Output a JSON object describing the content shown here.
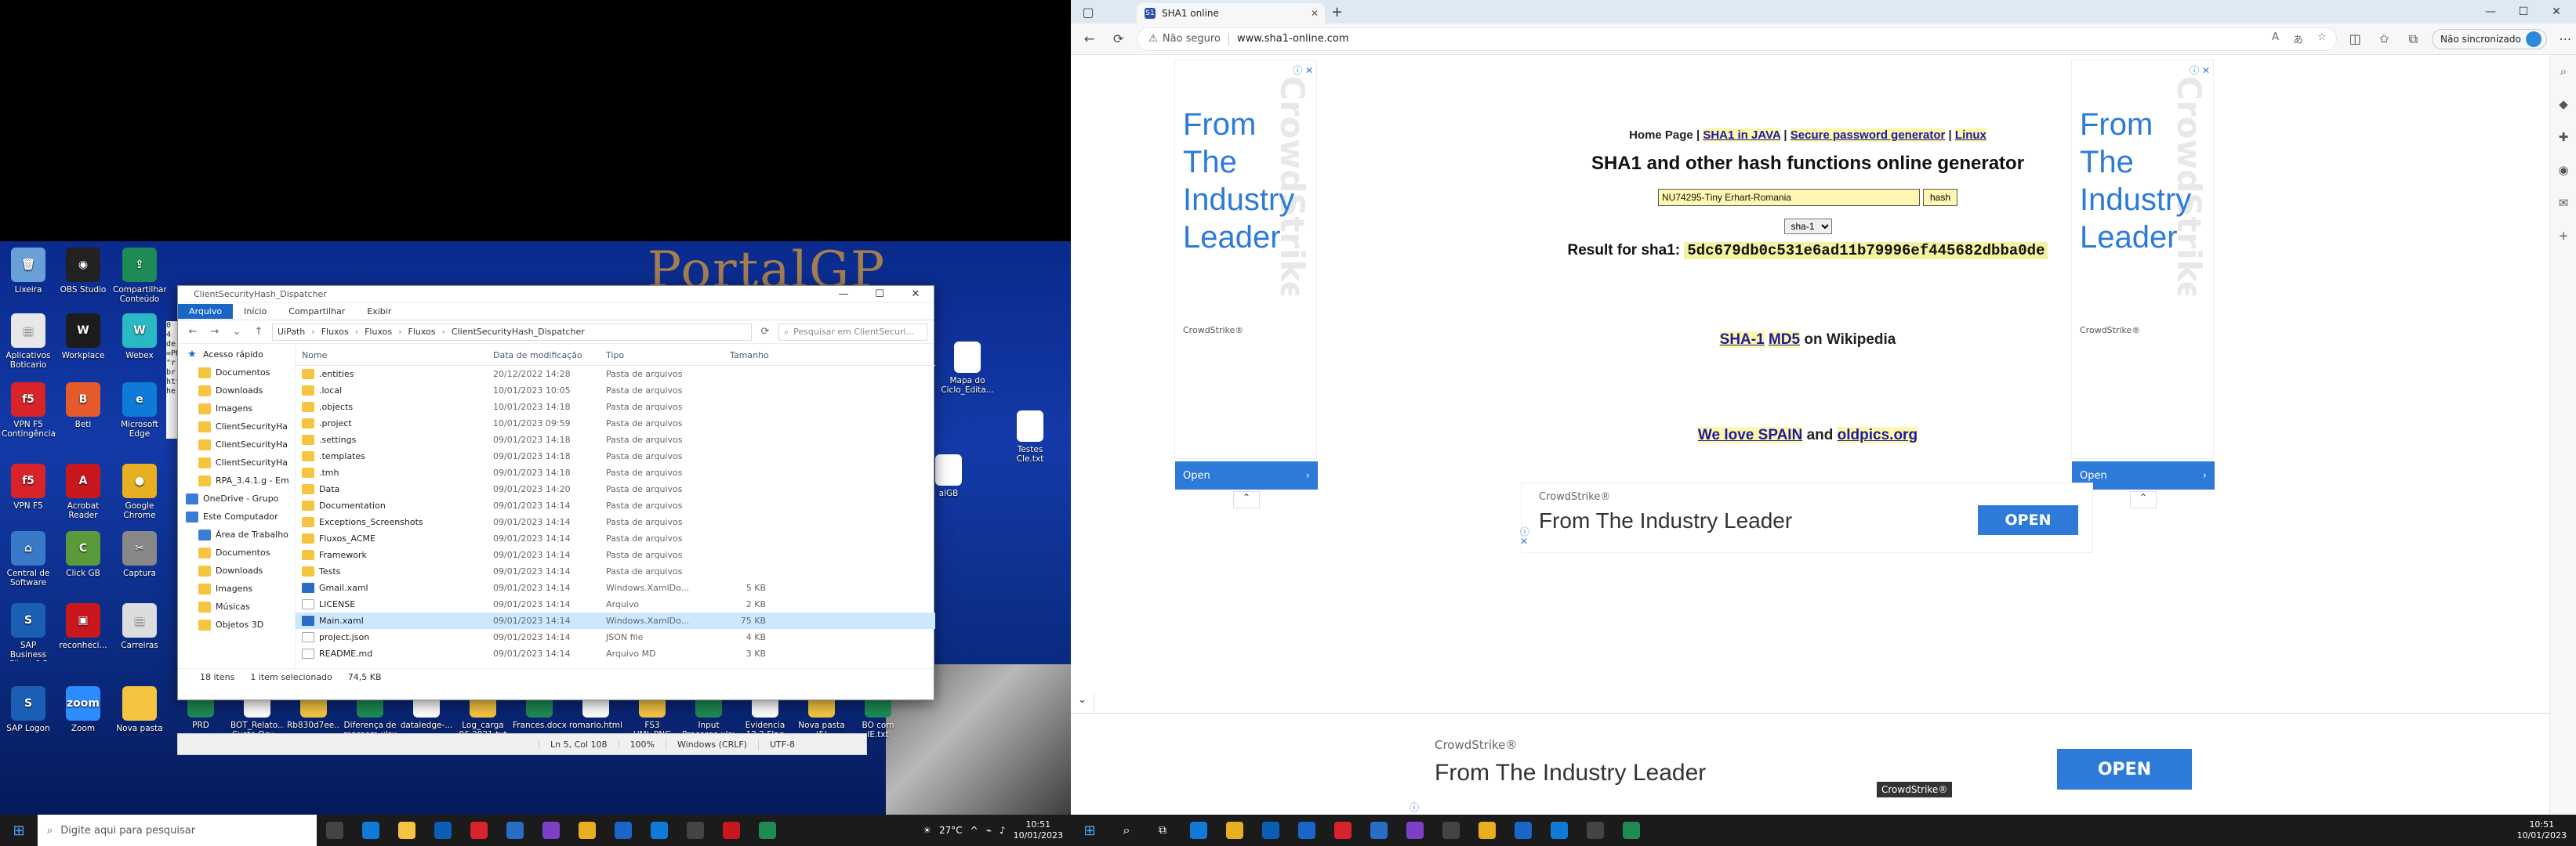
{
  "left_monitor": {
    "wallpaper_text": "PortalGP",
    "desktop_icons": [
      {
        "label": "Lixeira",
        "color": "#6aa0d8",
        "glyph": "🗑"
      },
      {
        "label": "OBS Studio",
        "color": "#222222",
        "glyph": "◉"
      },
      {
        "label": "Compartilhar Conteúdo",
        "color": "#1e8a54",
        "glyph": "⇪"
      },
      {
        "label": "Aplicativos Boticario",
        "color": "#e8e8e8",
        "glyph": "▤"
      },
      {
        "label": "Workplace",
        "color": "#1c1c1c",
        "glyph": "W"
      },
      {
        "label": "Webex",
        "color": "#2bb8c5",
        "glyph": "W"
      },
      {
        "label": "VPN F5 Contingência",
        "color": "#d8232a",
        "glyph": "f5"
      },
      {
        "label": "Beti",
        "color": "#e45a2b",
        "glyph": "B"
      },
      {
        "label": "Microsoft Edge",
        "color": "#0f7ad8",
        "glyph": "e"
      },
      {
        "label": "VPN F5",
        "color": "#d8232a",
        "glyph": "f5"
      },
      {
        "label": "Acrobat Reader",
        "color": "#c8181e",
        "glyph": "A"
      },
      {
        "label": "Google Chrome",
        "color": "#e8b020",
        "glyph": "●"
      },
      {
        "label": "Central de Software",
        "color": "#3a78c8",
        "glyph": "⌂"
      },
      {
        "label": "Click GB",
        "color": "#5a9a3a",
        "glyph": "C"
      },
      {
        "label": "Captura",
        "color": "#888888",
        "glyph": "✂"
      },
      {
        "label": "SAP Business Client 6.5",
        "color": "#1a5fb4",
        "glyph": "S"
      },
      {
        "label": "reconheci...",
        "color": "#c8181e",
        "glyph": "▣"
      },
      {
        "label": "Carreiras",
        "color": "#dddddd",
        "glyph": "▤"
      },
      {
        "label": "SAP Logon",
        "color": "#1a5fb4",
        "glyph": "S"
      },
      {
        "label": "Zoom",
        "color": "#2d8cff",
        "glyph": "zoom"
      },
      {
        "label": "Nova pasta",
        "color": "#f5c542",
        "glyph": ""
      }
    ],
    "taskbar_desktop_labels": [
      "PRD",
      "BOT_Relato... Custo Ocu...",
      "Rb830d7ee...",
      "Diferença de margem.xlsx",
      "dataledge-...",
      "Log_carga 06 2021.txt",
      "Frances.docx",
      "romario.html",
      "FS3 HML.PNG",
      "Input Processo.xlsx",
      "Evidencia 12.2 Flag",
      "Nova pasta (5)",
      "BO com IE.txt"
    ],
    "right_desktop_labels": [
      "Mapa do Ciclo_Edita...",
      "Testes CIe.txt",
      "alGB"
    ],
    "explorer": {
      "title": "ClientSecurityHash_Dispatcher",
      "window_buttons": [
        "—",
        "☐",
        "✕"
      ],
      "ribbon_tabs": [
        "Arquivo",
        "Início",
        "Compartilhar",
        "Exibir"
      ],
      "path": [
        "UiPath",
        "Fluxos",
        "Fluxos",
        "Fluxos",
        "ClientSecurityHash_Dispatcher"
      ],
      "search_placeholder": "Pesquisar em ClientSecuri...",
      "nav": [
        {
          "label": "Acesso rápido",
          "type": "star"
        },
        {
          "label": "Documentos",
          "type": "folder"
        },
        {
          "label": "Downloads",
          "type": "folder"
        },
        {
          "label": "Imagens",
          "type": "folder"
        },
        {
          "label": "ClientSecurityHa",
          "type": "folder"
        },
        {
          "label": "ClientSecurityHa",
          "type": "folder"
        },
        {
          "label": "ClientSecurityHa",
          "type": "folder"
        },
        {
          "label": "RPA_3.4.1.g - Em",
          "type": "folder"
        },
        {
          "label": "OneDrive - Grupo",
          "type": "blue"
        },
        {
          "label": "Este Computador",
          "type": "blue"
        },
        {
          "label": "Área de Trabalho",
          "type": "blue"
        },
        {
          "label": "Documentos",
          "type": "folder"
        },
        {
          "label": "Downloads",
          "type": "folder"
        },
        {
          "label": "Imagens",
          "type": "folder"
        },
        {
          "label": "Músicas",
          "type": "folder"
        },
        {
          "label": "Objetos 3D",
          "type": "folder"
        }
      ],
      "columns": [
        "Nome",
        "Data de modificação",
        "Tipo",
        "Tamanho"
      ],
      "rows": [
        {
          "name": ".entities",
          "date": "20/12/2022 14:28",
          "type": "Pasta de arquivos",
          "size": "",
          "kind": "folder"
        },
        {
          "name": ".local",
          "date": "10/01/2023 10:05",
          "type": "Pasta de arquivos",
          "size": "",
          "kind": "folder"
        },
        {
          "name": ".objects",
          "date": "10/01/2023 14:18",
          "type": "Pasta de arquivos",
          "size": "",
          "kind": "folder"
        },
        {
          "name": ".project",
          "date": "10/01/2023 09:59",
          "type": "Pasta de arquivos",
          "size": "",
          "kind": "folder"
        },
        {
          "name": ".settings",
          "date": "09/01/2023 14:18",
          "type": "Pasta de arquivos",
          "size": "",
          "kind": "folder"
        },
        {
          "name": ".templates",
          "date": "09/01/2023 14:18",
          "type": "Pasta de arquivos",
          "size": "",
          "kind": "folder"
        },
        {
          "name": ".tmh",
          "date": "09/01/2023 14:18",
          "type": "Pasta de arquivos",
          "size": "",
          "kind": "folder"
        },
        {
          "name": "Data",
          "date": "09/01/2023 14:20",
          "type": "Pasta de arquivos",
          "size": "",
          "kind": "folder"
        },
        {
          "name": "Documentation",
          "date": "09/01/2023 14:14",
          "type": "Pasta de arquivos",
          "size": "",
          "kind": "folder"
        },
        {
          "name": "Exceptions_Screenshots",
          "date": "09/01/2023 14:14",
          "type": "Pasta de arquivos",
          "size": "",
          "kind": "folder"
        },
        {
          "name": "Fluxos_ACME",
          "date": "09/01/2023 14:14",
          "type": "Pasta de arquivos",
          "size": "",
          "kind": "folder"
        },
        {
          "name": "Framework",
          "date": "09/01/2023 14:14",
          "type": "Pasta de arquivos",
          "size": "",
          "kind": "folder"
        },
        {
          "name": "Tests",
          "date": "09/01/2023 14:14",
          "type": "Pasta de arquivos",
          "size": "",
          "kind": "folder"
        },
        {
          "name": "Gmail.xaml",
          "date": "09/01/2023 14:14",
          "type": "Windows.XamlDo...",
          "size": "5 KB",
          "kind": "xaml"
        },
        {
          "name": "LICENSE",
          "date": "09/01/2023 14:14",
          "type": "Arquivo",
          "size": "2 KB",
          "kind": "file"
        },
        {
          "name": "Main.xaml",
          "date": "09/01/2023 14:14",
          "type": "Windows.XamlDo...",
          "size": "75 KB",
          "kind": "xaml"
        },
        {
          "name": "project.json",
          "date": "09/01/2023 14:14",
          "type": "JSON file",
          "size": "4 KB",
          "kind": "file"
        },
        {
          "name": "README.md",
          "date": "09/01/2023 14:14",
          "type": "Arquivo MD",
          "size": "3 KB",
          "kind": "file"
        }
      ],
      "selected_row": 15,
      "status": {
        "count": "18 itens",
        "selected": "1 item selecionado",
        "size": "74,5 KB"
      }
    },
    "notepad_status": [
      "Ln 5, Col 108",
      "100%",
      "Windows (CRLF)",
      "UTF-8"
    ],
    "notepad_side_lines": [
      "0 4",
      "de",
      "=PR",
      "\"r",
      "br",
      "htt",
      "he"
    ],
    "taskbar": {
      "search_placeholder": "Digite aqui para pesquisar",
      "apps": [
        "#444444",
        "#0f7ad8",
        "#f5c542",
        "#0a5fb4",
        "#d8232a",
        "#2b6cc4",
        "#7b3fc8",
        "#e8b020",
        "#1a66c8",
        "#0f7ad8",
        "#444444",
        "#c8181e",
        "#1e8a54"
      ],
      "weather": "27°C",
      "time": "10:51",
      "date": "10/01/2023"
    }
  },
  "browser": {
    "tab_title": "SHA1 online",
    "favicon": "S1",
    "window_buttons": [
      "—",
      "☐",
      "✕"
    ],
    "security_label": "Não seguro",
    "url": "www.sha1-online.com",
    "sync_label": "Não sincronizado",
    "page": {
      "home_link": "Home Page",
      "links": [
        "SHA1 in JAVA",
        "Secure password generator",
        "Linux"
      ],
      "title": "SHA1 and other hash functions online generator",
      "input_value": "NU74295-Tiny Erhart-Romania",
      "hash_button": "hash",
      "algorithm": "sha-1",
      "result_label": "Result for sha1:",
      "result_hash": "5dc679db0c531e6ad11b79996ef445682dbba0de",
      "wiki_sha1": "SHA-1",
      "wiki_md5": "MD5",
      "wiki_suffix": "on Wikipedia",
      "love_spain": "We love SPAIN",
      "love_and": "and",
      "love_oldpics": "oldpics.org"
    },
    "ads": {
      "sky_headline_lines": [
        "From",
        "The",
        "Industry",
        "Leader"
      ],
      "sky_watermark": "CrowdStrike",
      "brand": "CrowdStrike®",
      "open_label": "Open",
      "mid_brand": "CrowdStrike®",
      "mid_headline": "From The Industry Leader",
      "mid_open": "OPEN",
      "bottom_brand": "CrowdStrike®",
      "bottom_headline": "From The Industry Leader",
      "bottom_open": "OPEN",
      "bottom_tag": "CrowdStrike®"
    },
    "taskbar": {
      "apps": [
        "#0f7ad8",
        "#e8b020",
        "#0a5fb4",
        "#1a66c8",
        "#d8232a",
        "#2b6cc4",
        "#7b3fc8",
        "#444444",
        "#e8b020",
        "#1a66c8",
        "#0f7ad8",
        "#444444",
        "#1e8a54"
      ],
      "time": "10:51",
      "date": "10/01/2023"
    }
  }
}
